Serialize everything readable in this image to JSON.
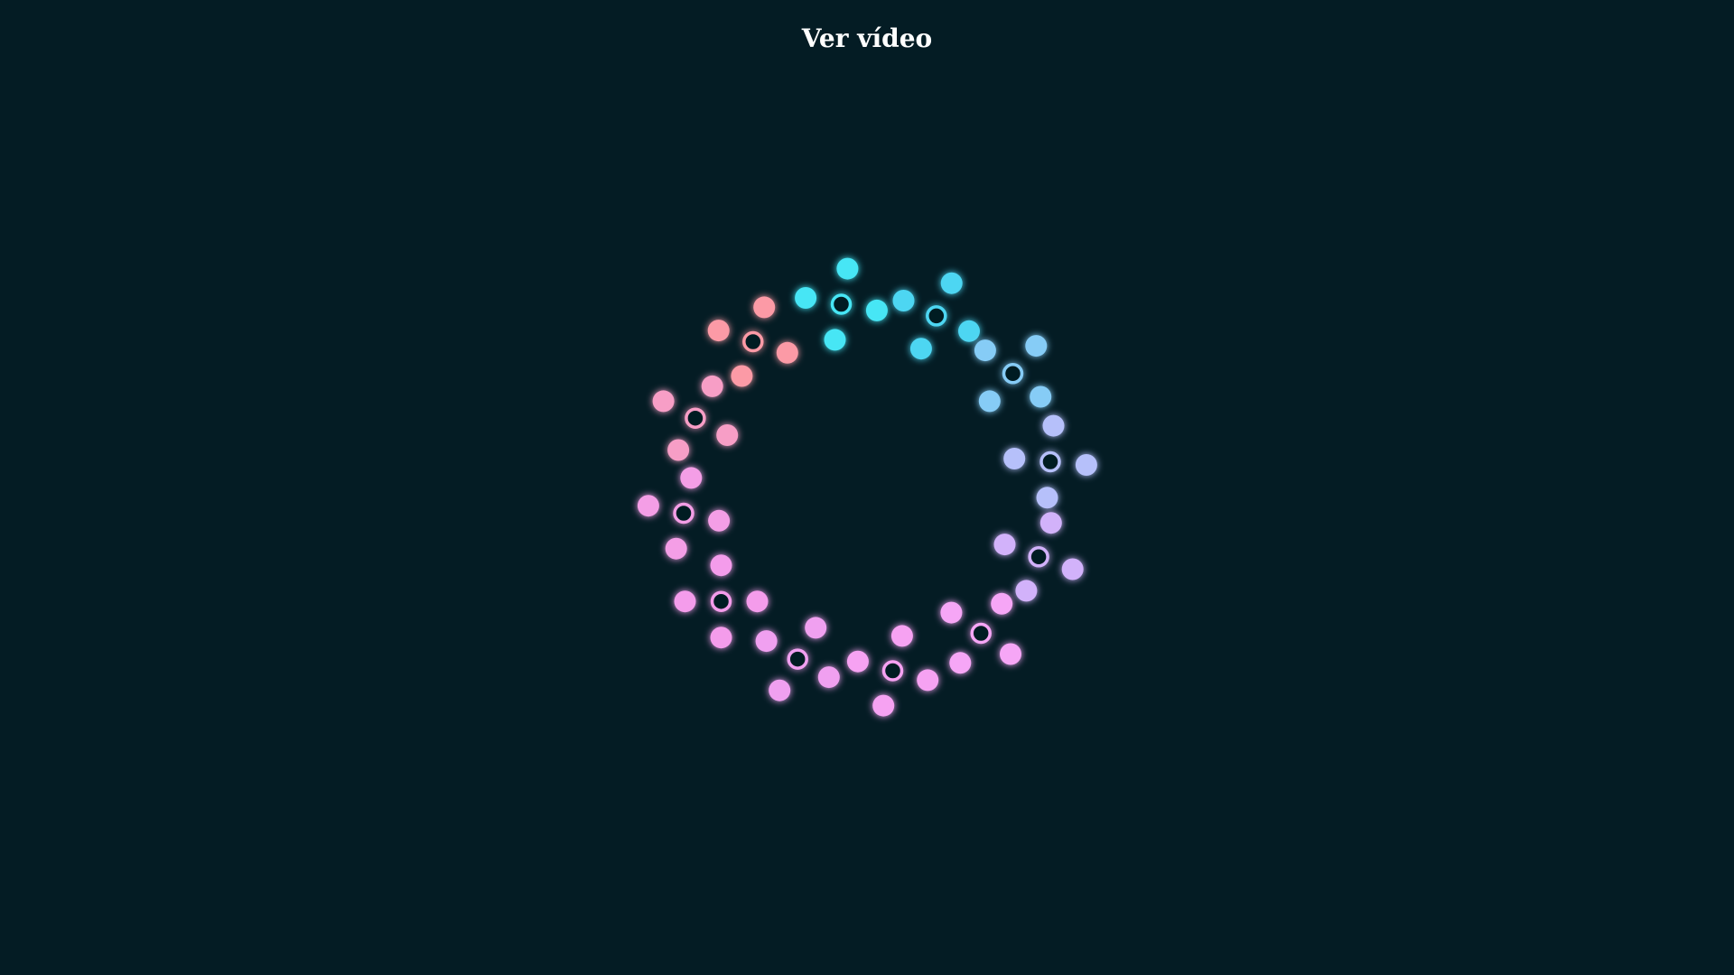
{
  "header": {
    "title": "Ver vídeo"
  },
  "loader": {
    "icon": "flower-ring-spinner-icon",
    "clusters": 12,
    "background_color": "#041c24",
    "palette": [
      "#46e6f5",
      "#4ed6f2",
      "#86ccf6",
      "#b6c0fa",
      "#d2b2fa",
      "#f6a6f6",
      "#f6a2f2",
      "#f0a0f0",
      "#f49ceb",
      "#f49ee6",
      "#f79ec6",
      "#fc9aa6"
    ]
  }
}
